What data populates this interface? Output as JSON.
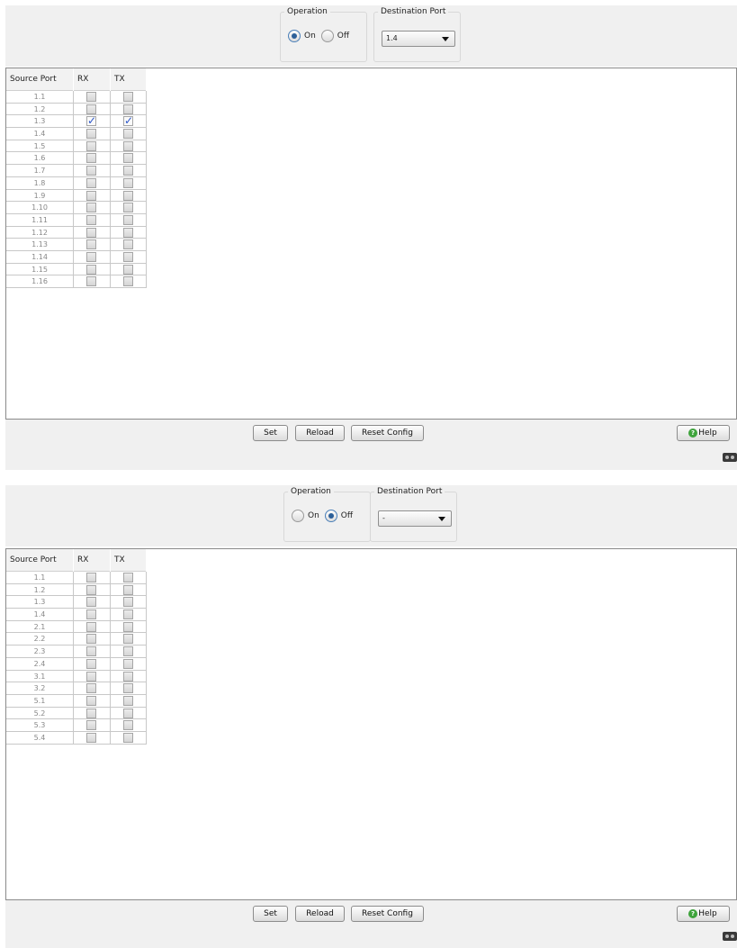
{
  "panels": [
    {
      "operation": {
        "legend": "Operation",
        "on_label": "On",
        "off_label": "Off",
        "selected": "On"
      },
      "destination": {
        "legend": "Destination Port",
        "value": "1.4"
      },
      "table": {
        "headers": {
          "source": "Source Port",
          "rx": "RX",
          "tx": "TX"
        },
        "rows": [
          {
            "port": "1.1",
            "rx": false,
            "tx": false
          },
          {
            "port": "1.2",
            "rx": false,
            "tx": false
          },
          {
            "port": "1.3",
            "rx": true,
            "tx": true
          },
          {
            "port": "1.4",
            "rx": false,
            "tx": false
          },
          {
            "port": "1.5",
            "rx": false,
            "tx": false
          },
          {
            "port": "1.6",
            "rx": false,
            "tx": false
          },
          {
            "port": "1.7",
            "rx": false,
            "tx": false
          },
          {
            "port": "1.8",
            "rx": false,
            "tx": false
          },
          {
            "port": "1.9",
            "rx": false,
            "tx": false
          },
          {
            "port": "1.10",
            "rx": false,
            "tx": false
          },
          {
            "port": "1.11",
            "rx": false,
            "tx": false
          },
          {
            "port": "1.12",
            "rx": false,
            "tx": false
          },
          {
            "port": "1.13",
            "rx": false,
            "tx": false
          },
          {
            "port": "1.14",
            "rx": false,
            "tx": false
          },
          {
            "port": "1.15",
            "rx": false,
            "tx": false
          },
          {
            "port": "1.16",
            "rx": false,
            "tx": false
          }
        ]
      },
      "buttons": {
        "set": "Set",
        "reload": "Reload",
        "reset": "Reset Config",
        "help": "Help"
      }
    },
    {
      "operation": {
        "legend": "Operation",
        "on_label": "On",
        "off_label": "Off",
        "selected": "Off"
      },
      "destination": {
        "legend": "Destination Port",
        "value": "-"
      },
      "table": {
        "headers": {
          "source": "Source Port",
          "rx": "RX",
          "tx": "TX"
        },
        "rows": [
          {
            "port": "1.1",
            "rx": false,
            "tx": false
          },
          {
            "port": "1.2",
            "rx": false,
            "tx": false
          },
          {
            "port": "1.3",
            "rx": false,
            "tx": false
          },
          {
            "port": "1.4",
            "rx": false,
            "tx": false
          },
          {
            "port": "2.1",
            "rx": false,
            "tx": false
          },
          {
            "port": "2.2",
            "rx": false,
            "tx": false
          },
          {
            "port": "2.3",
            "rx": false,
            "tx": false
          },
          {
            "port": "2.4",
            "rx": false,
            "tx": false
          },
          {
            "port": "3.1",
            "rx": false,
            "tx": false
          },
          {
            "port": "3.2",
            "rx": false,
            "tx": false
          },
          {
            "port": "5.1",
            "rx": false,
            "tx": false
          },
          {
            "port": "5.2",
            "rx": false,
            "tx": false
          },
          {
            "port": "5.3",
            "rx": false,
            "tx": false
          },
          {
            "port": "5.4",
            "rx": false,
            "tx": false
          }
        ]
      },
      "buttons": {
        "set": "Set",
        "reload": "Reload",
        "reset": "Reset Config",
        "help": "Help"
      }
    }
  ],
  "colors": {
    "accent": "#2c5f99",
    "check": "#2b56c9",
    "help": "#3ea33b"
  }
}
